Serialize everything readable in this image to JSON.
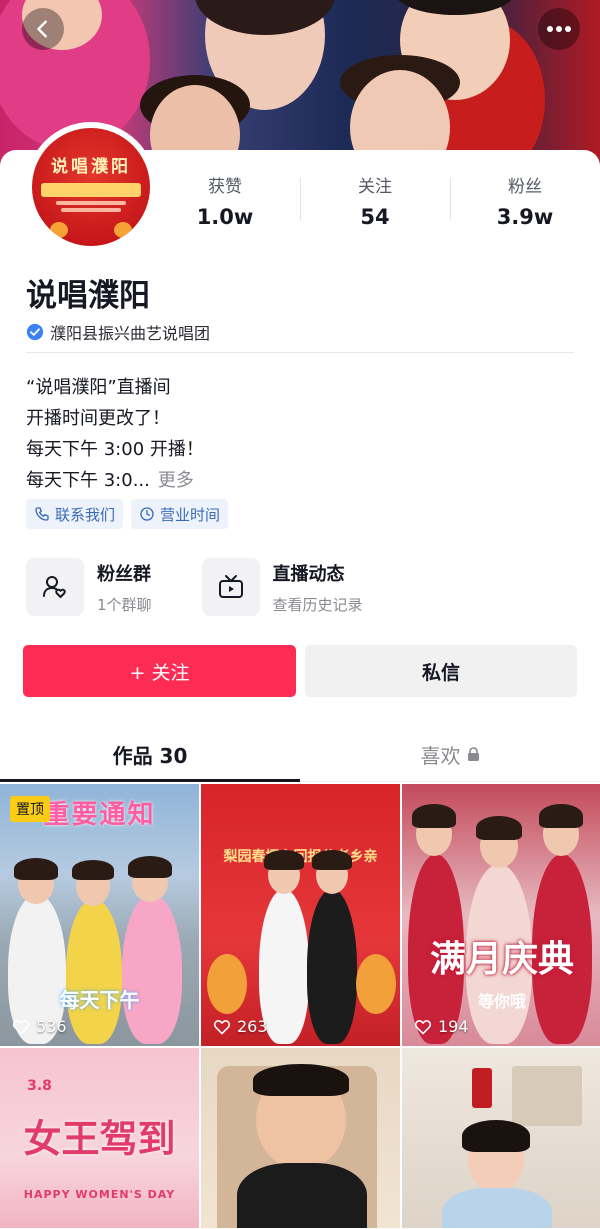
{
  "header": {
    "back_icon": "chevron-left-icon",
    "more_icon": "more-dots-icon"
  },
  "profile": {
    "avatar_text": "说唱濮阳",
    "name": "说唱濮阳",
    "verified_label": "濮阳县振兴曲艺说唱团",
    "stats": [
      {
        "label": "获赞",
        "value": "1.0w"
      },
      {
        "label": "关注",
        "value": "54"
      },
      {
        "label": "粉丝",
        "value": "3.9w"
      }
    ],
    "bio": {
      "line1": "“说唱濮阳”直播间",
      "line2": "开播时间更改了！",
      "line3": "每天下午 3:00 开播！",
      "line4": "每天下午 3:0...",
      "more": "更多"
    },
    "tags": [
      {
        "label": "联系我们",
        "icon": "phone-icon"
      },
      {
        "label": "营业时间",
        "icon": "clock-icon"
      }
    ],
    "features": [
      {
        "title": "粉丝群",
        "subtitle": "1个群聊",
        "icon": "fan-group-icon"
      },
      {
        "title": "直播动态",
        "subtitle": "查看历史记录",
        "icon": "tv-icon"
      }
    ]
  },
  "actions": {
    "follow": "+ 关注",
    "message": "私信"
  },
  "tabs": [
    {
      "label": "作品 30",
      "active": true
    },
    {
      "label": "喜欢",
      "active": false,
      "icon": "lock-icon"
    }
  ],
  "videos": [
    {
      "likes": "536",
      "pinned": "置顶",
      "overlay_top": "重要通知",
      "overlay_bottom": "每天下午"
    },
    {
      "likes": "263",
      "overlay_top": "梨园春擂主回报父老乡亲"
    },
    {
      "likes": "194",
      "overlay_top": "满月庆典",
      "overlay_bottom": "等你哦"
    },
    {
      "overlay_top": "3.8",
      "overlay_mid": "女王驾到",
      "overlay_bottom": "HAPPY WOMEN'S DAY"
    },
    {},
    {}
  ],
  "colors": {
    "accent": "#fe2c55",
    "verified": "#3b82f6",
    "pin": "#facc15"
  }
}
